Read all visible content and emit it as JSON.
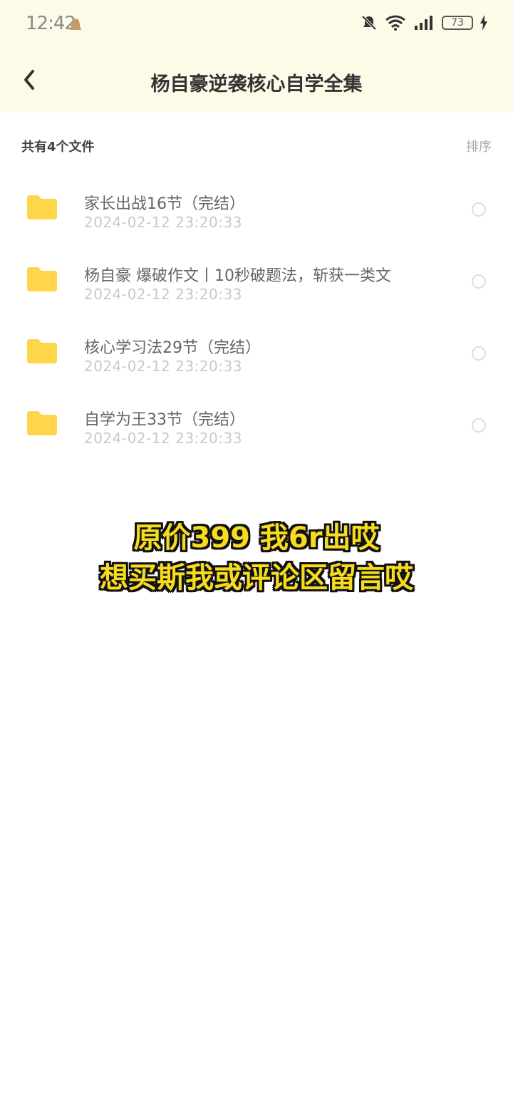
{
  "status": {
    "time": "12:42",
    "battery": "73"
  },
  "nav": {
    "title": "杨自豪逆袭核心自学全集"
  },
  "header": {
    "count_label": "共有4个文件",
    "sort_label": "排序"
  },
  "files": [
    {
      "name": "家长出战16节（完结）",
      "date": "2024-02-12  23:20:33"
    },
    {
      "name": "杨自豪 爆破作文丨10秒破题法，斩获一类文",
      "date": "2024-02-12  23:20:33"
    },
    {
      "name": "核心学习法29节（完结）",
      "date": "2024-02-12  23:20:33"
    },
    {
      "name": "自学为王33节（完结）",
      "date": "2024-02-12  23:20:33"
    }
  ],
  "overlay": {
    "line1": "原价399 我6r出哎",
    "line2": "想买斯我或评论区留言哎"
  },
  "colors": {
    "folder": "#ffd54a",
    "topbar_bg": "#fdfbe8",
    "overlay_text": "#f7dc1e"
  }
}
